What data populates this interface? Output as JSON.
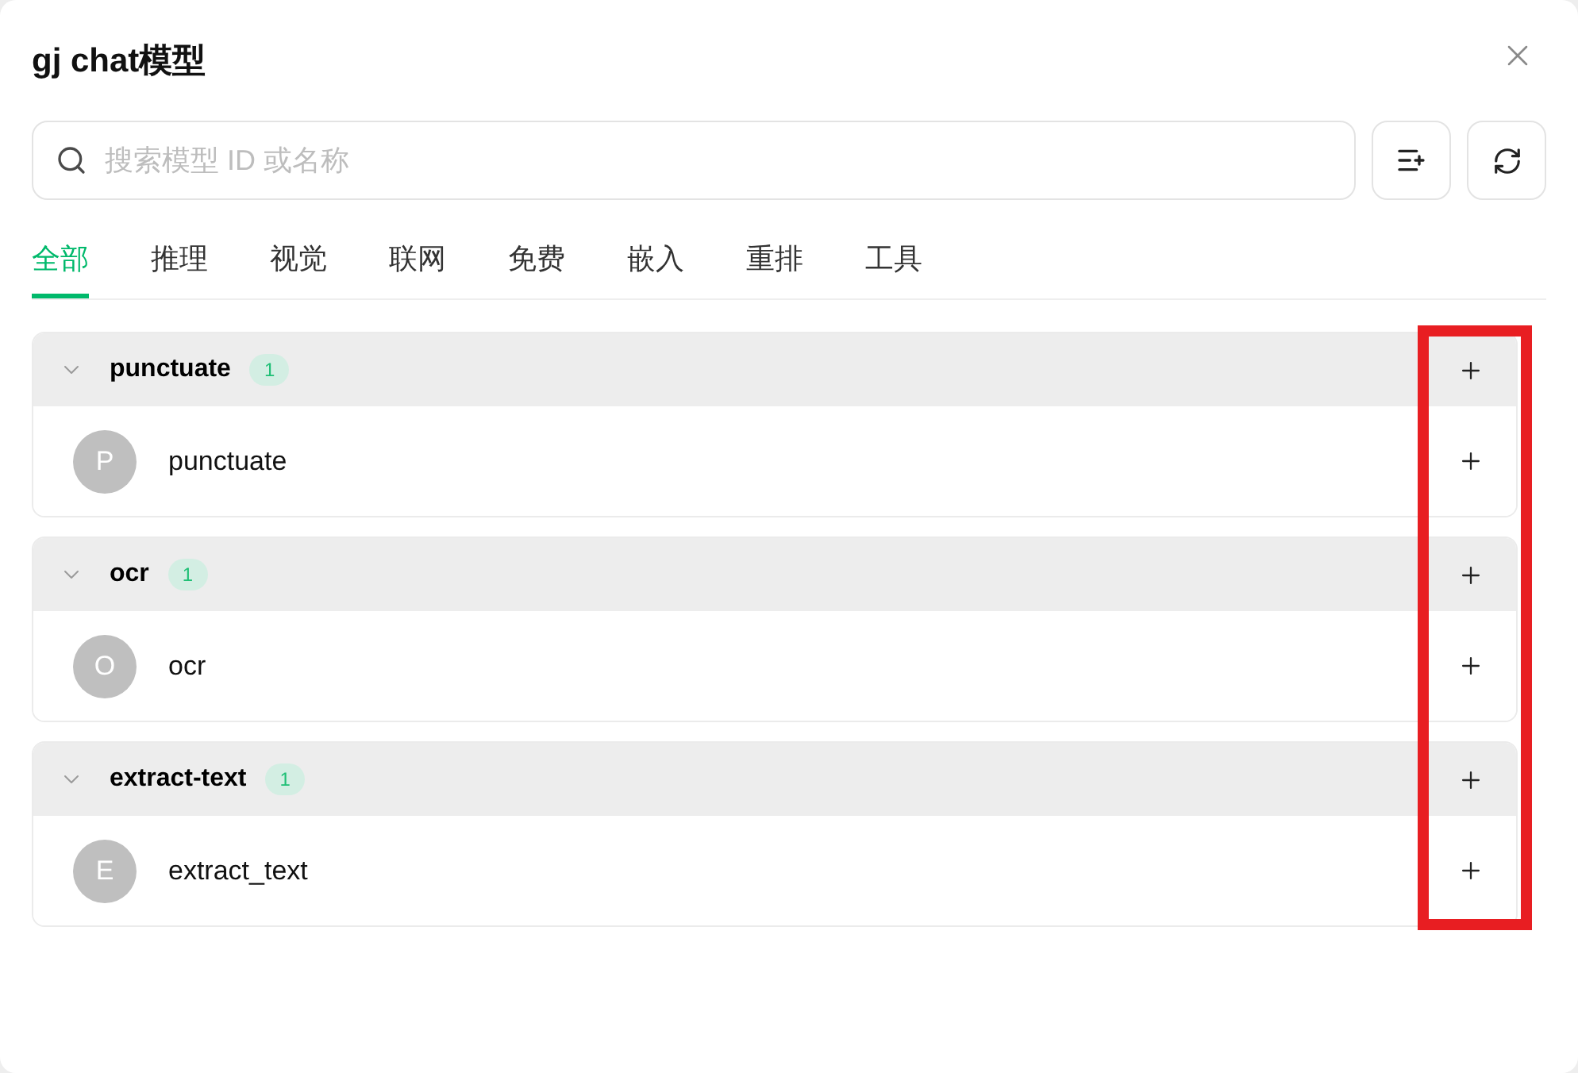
{
  "dialog": {
    "title": "gj chat模型"
  },
  "search": {
    "placeholder": "搜索模型 ID 或名称"
  },
  "tabs": [
    {
      "label": "全部",
      "selected": true
    },
    {
      "label": "推理",
      "selected": false
    },
    {
      "label": "视觉",
      "selected": false
    },
    {
      "label": "联网",
      "selected": false
    },
    {
      "label": "免费",
      "selected": false
    },
    {
      "label": "嵌入",
      "selected": false
    },
    {
      "label": "重排",
      "selected": false
    },
    {
      "label": "工具",
      "selected": false
    }
  ],
  "groups": [
    {
      "name": "punctuate",
      "count": "1",
      "expanded": true,
      "models": [
        {
          "avatar": "P",
          "name": "punctuate"
        }
      ]
    },
    {
      "name": "ocr",
      "count": "1",
      "expanded": true,
      "models": [
        {
          "avatar": "O",
          "name": "ocr"
        }
      ]
    },
    {
      "name": "extract-text",
      "count": "1",
      "expanded": true,
      "models": [
        {
          "avatar": "E",
          "name": "extract_text"
        }
      ]
    }
  ],
  "highlight_frame": true
}
